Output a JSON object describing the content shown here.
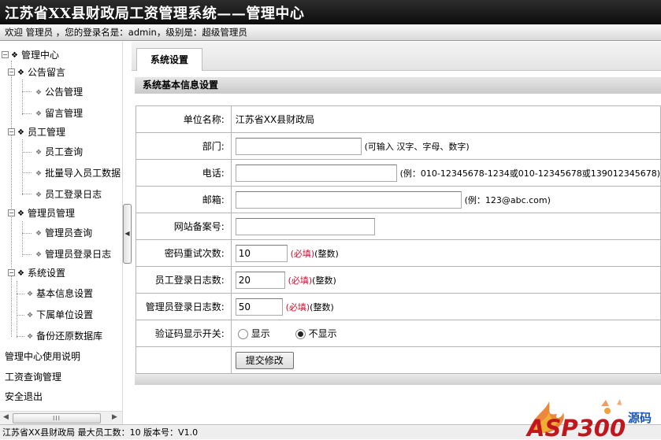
{
  "header": {
    "title": "江苏省XX县财政局工资管理系统——管理中心",
    "welcome": "欢迎 管理员 ，您的登录名是：admin，级别是：超级管理员"
  },
  "sidebar": {
    "root": "管理中心",
    "groups": [
      {
        "label": "公告留言",
        "items": [
          "公告管理",
          "留言管理"
        ]
      },
      {
        "label": "员工管理",
        "items": [
          "员工查询",
          "批量导入员工数据",
          "员工登录日志"
        ]
      },
      {
        "label": "管理员管理",
        "items": [
          "管理员查询",
          "管理员登录日志"
        ]
      },
      {
        "label": "系统设置",
        "items": [
          "基本信息设置",
          "下属单位设置",
          "备份还原数据库"
        ]
      }
    ],
    "links": [
      "管理中心使用说明",
      "工资查询管理",
      "安全退出"
    ],
    "scrollbar_grip": "III"
  },
  "main": {
    "tab_label": "系统设置",
    "section_title": "系统基本信息设置",
    "rows": [
      {
        "label": "单位名称:",
        "value": "江苏省XX县财政局"
      },
      {
        "label": "部门:",
        "value": "",
        "hint": "(可输入 汉字、字母、数字)"
      },
      {
        "label": "电话:",
        "value": "",
        "hint": "(例：010-12345678-1234或010-12345678或139012345678)"
      },
      {
        "label": "邮箱:",
        "value": "",
        "hint": "(例：123@abc.com)"
      },
      {
        "label": "网站备案号:",
        "value": ""
      },
      {
        "label": "密码重试次数:",
        "value": "10",
        "required": "(必填)",
        "type_note": "(整数)"
      },
      {
        "label": "员工登录日志数:",
        "value": "20",
        "required": "(必填)",
        "type_note": "(整数)"
      },
      {
        "label": "管理员登录日志数:",
        "value": "50",
        "required": "(必填)",
        "type_note": "(整数)"
      },
      {
        "label": "验证码显示开关:",
        "options": [
          "显示",
          "不显示"
        ],
        "selected": "不显示"
      }
    ],
    "submit_label": "提交修改"
  },
  "status_bar": "江苏省XX县财政局 最大员工数：10 版本号：V1.0",
  "watermark": {
    "text": "ASP300",
    "suffix": "源码"
  },
  "colors": {
    "header_bg": "#111111",
    "required_red": "#c8102e",
    "logo_red": "#c0161d",
    "logo_blue": "#1a56b3"
  }
}
